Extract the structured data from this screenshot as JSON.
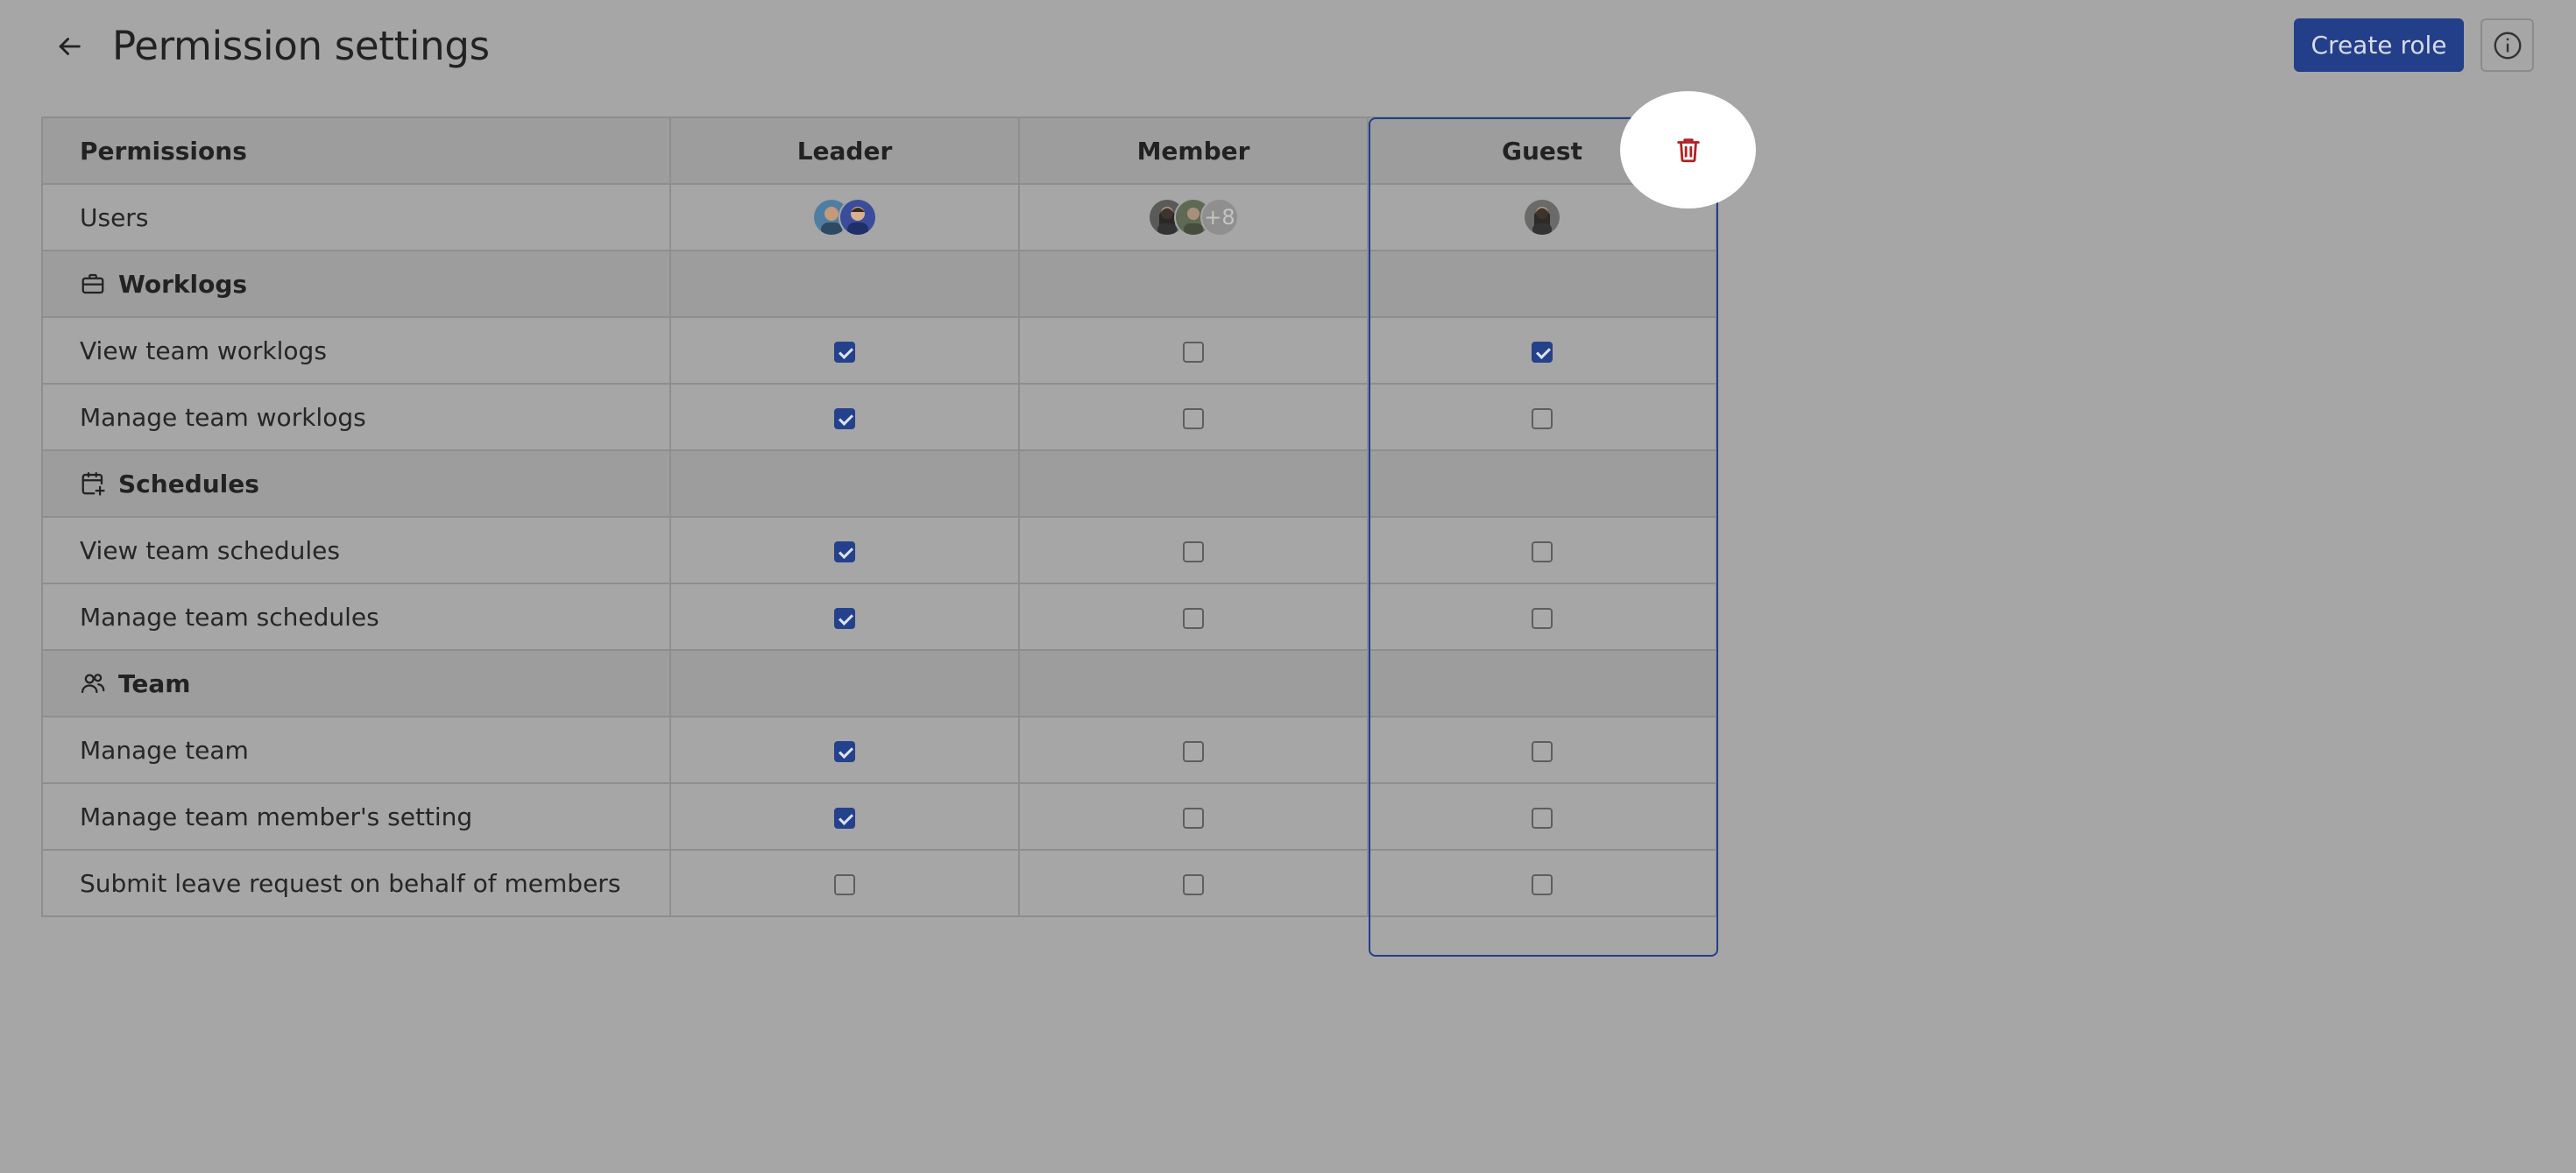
{
  "header": {
    "back_icon": "arrow-left-icon",
    "title": "Permission settings",
    "create_role_label": "Create role",
    "info_icon": "info-icon"
  },
  "table": {
    "columns": [
      "Permissions",
      "Leader",
      "Member",
      "Guest"
    ],
    "users_row": {
      "label": "Users",
      "leader_avatars": 2,
      "member_avatars": 2,
      "member_more": "+8",
      "guest_avatars": 1
    },
    "sections": [
      {
        "title": "Worklogs",
        "icon": "briefcase-icon",
        "rows": [
          {
            "label": "View team worklogs",
            "values": [
              true,
              false,
              true
            ]
          },
          {
            "label": "Manage team worklogs",
            "values": [
              true,
              false,
              false
            ]
          }
        ]
      },
      {
        "title": "Schedules",
        "icon": "calendar-plus-icon",
        "rows": [
          {
            "label": "View team schedules",
            "values": [
              true,
              false,
              false
            ]
          },
          {
            "label": "Manage team schedules",
            "values": [
              true,
              false,
              false
            ]
          }
        ]
      },
      {
        "title": "Team",
        "icon": "users-icon",
        "rows": [
          {
            "label": "Manage team",
            "values": [
              true,
              false,
              false
            ]
          },
          {
            "label": "Manage team member's setting",
            "values": [
              true,
              false,
              false
            ]
          },
          {
            "label": "Submit leave request on behalf of members",
            "values": [
              false,
              false,
              false
            ]
          }
        ]
      }
    ]
  },
  "delete_role_icon": "trash-icon",
  "colors": {
    "accent": "#233f8a",
    "delete": "#b22222",
    "overlay_background": "#a6a6a6"
  }
}
